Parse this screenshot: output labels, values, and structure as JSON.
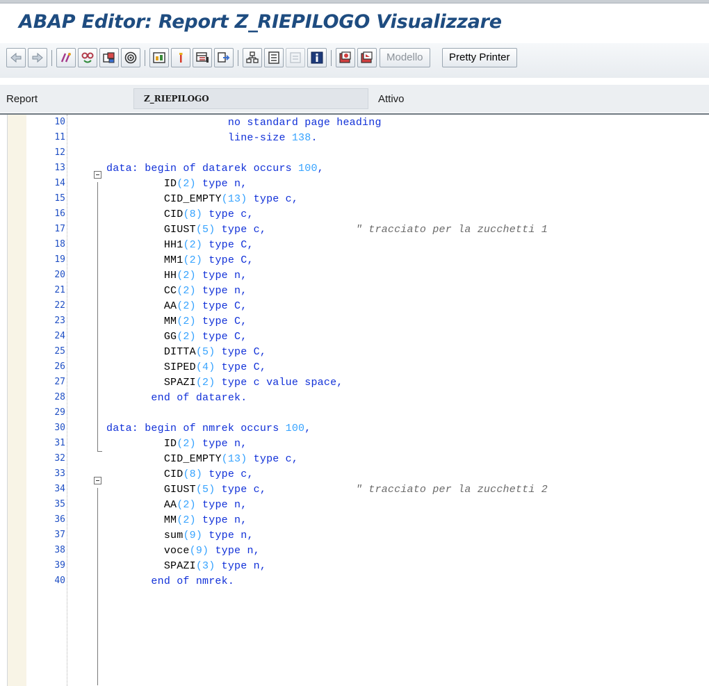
{
  "window": {
    "title": "ABAP Editor: Report Z_RIEPILOGO Visualizzare"
  },
  "toolbar": {
    "icons": [
      "back-arrow-icon",
      "forward-arrow-icon",
      "toggle-display-change-icon",
      "other-object-icon",
      "activate-icon",
      "where-used-icon",
      "navigate-icon",
      "object-list-icon",
      "display-object-icon",
      "insert-statement-icon",
      "breakpoint-icon",
      "bookmark-icon",
      "test-icon",
      "help-icon",
      "debug-icon",
      "session-debug-icon"
    ],
    "modello_label": "Modello",
    "pretty_printer_label": "Pretty Printer"
  },
  "report": {
    "label": "Report",
    "value": "Z_RIEPILOGO",
    "status": "Attivo"
  },
  "colors": {
    "keyword": "#1030d8",
    "number": "#36a3ff",
    "comment": "#6a6a6a",
    "linenum": "#1f4fc4",
    "title": "#1e4c80"
  },
  "code_lines": [
    {
      "n": "10",
      "parts": [
        {
          "t": "                   ",
          "k": "plain"
        },
        {
          "t": "no standard page heading",
          "k": "keyword"
        }
      ]
    },
    {
      "n": "11",
      "parts": [
        {
          "t": "                   ",
          "k": "plain"
        },
        {
          "t": "line-size ",
          "k": "keyword"
        },
        {
          "t": "138",
          "k": "number"
        },
        {
          "t": ".",
          "k": "keyword"
        }
      ]
    },
    {
      "n": "12",
      "parts": []
    },
    {
      "n": "13",
      "parts": [
        {
          "t": "data: begin of datarek occurs ",
          "k": "keyword"
        },
        {
          "t": "100",
          "k": "number"
        },
        {
          "t": ",",
          "k": "keyword"
        }
      ]
    },
    {
      "n": "14",
      "parts": [
        {
          "t": "         ",
          "k": "plain"
        },
        {
          "t": "ID",
          "k": "plain"
        },
        {
          "t": "(2)",
          "k": "number"
        },
        {
          "t": " type n,",
          "k": "keyword"
        }
      ]
    },
    {
      "n": "15",
      "parts": [
        {
          "t": "         ",
          "k": "plain"
        },
        {
          "t": "CID_EMPTY",
          "k": "plain"
        },
        {
          "t": "(13)",
          "k": "number"
        },
        {
          "t": " type c,",
          "k": "keyword"
        }
      ]
    },
    {
      "n": "16",
      "parts": [
        {
          "t": "         ",
          "k": "plain"
        },
        {
          "t": "CID",
          "k": "plain"
        },
        {
          "t": "(8)",
          "k": "number"
        },
        {
          "t": " type c,",
          "k": "keyword"
        }
      ]
    },
    {
      "n": "17",
      "parts": [
        {
          "t": "         ",
          "k": "plain"
        },
        {
          "t": "GIUST",
          "k": "plain"
        },
        {
          "t": "(5)",
          "k": "number"
        },
        {
          "t": " type c,",
          "k": "keyword"
        },
        {
          "t": "              \" tracciato per la zucchetti 1",
          "k": "comment"
        }
      ]
    },
    {
      "n": "18",
      "parts": [
        {
          "t": "         ",
          "k": "plain"
        },
        {
          "t": "HH1",
          "k": "plain"
        },
        {
          "t": "(2)",
          "k": "number"
        },
        {
          "t": " type C,",
          "k": "keyword"
        }
      ]
    },
    {
      "n": "19",
      "parts": [
        {
          "t": "         ",
          "k": "plain"
        },
        {
          "t": "MM1",
          "k": "plain"
        },
        {
          "t": "(2)",
          "k": "number"
        },
        {
          "t": " type C,",
          "k": "keyword"
        }
      ]
    },
    {
      "n": "20",
      "parts": [
        {
          "t": "         ",
          "k": "plain"
        },
        {
          "t": "HH",
          "k": "plain"
        },
        {
          "t": "(2)",
          "k": "number"
        },
        {
          "t": " type n,",
          "k": "keyword"
        }
      ]
    },
    {
      "n": "21",
      "parts": [
        {
          "t": "         ",
          "k": "plain"
        },
        {
          "t": "CC",
          "k": "plain"
        },
        {
          "t": "(2)",
          "k": "number"
        },
        {
          "t": " type n,",
          "k": "keyword"
        }
      ]
    },
    {
      "n": "22",
      "parts": [
        {
          "t": "         ",
          "k": "plain"
        },
        {
          "t": "AA",
          "k": "plain"
        },
        {
          "t": "(2)",
          "k": "number"
        },
        {
          "t": " type C,",
          "k": "keyword"
        }
      ]
    },
    {
      "n": "23",
      "parts": [
        {
          "t": "         ",
          "k": "plain"
        },
        {
          "t": "MM",
          "k": "plain"
        },
        {
          "t": "(2)",
          "k": "number"
        },
        {
          "t": " type C,",
          "k": "keyword"
        }
      ]
    },
    {
      "n": "24",
      "parts": [
        {
          "t": "         ",
          "k": "plain"
        },
        {
          "t": "GG",
          "k": "plain"
        },
        {
          "t": "(2)",
          "k": "number"
        },
        {
          "t": " type C,",
          "k": "keyword"
        }
      ]
    },
    {
      "n": "25",
      "parts": [
        {
          "t": "         ",
          "k": "plain"
        },
        {
          "t": "DITTA",
          "k": "plain"
        },
        {
          "t": "(5)",
          "k": "number"
        },
        {
          "t": " type C,",
          "k": "keyword"
        }
      ]
    },
    {
      "n": "26",
      "parts": [
        {
          "t": "         ",
          "k": "plain"
        },
        {
          "t": "SIPED",
          "k": "plain"
        },
        {
          "t": "(4)",
          "k": "number"
        },
        {
          "t": " type C,",
          "k": "keyword"
        }
      ]
    },
    {
      "n": "27",
      "parts": [
        {
          "t": "         ",
          "k": "plain"
        },
        {
          "t": "SPAZI",
          "k": "plain"
        },
        {
          "t": "(2)",
          "k": "number"
        },
        {
          "t": " type c value space,",
          "k": "keyword"
        }
      ]
    },
    {
      "n": "28",
      "parts": [
        {
          "t": "       ",
          "k": "plain"
        },
        {
          "t": "end of datarek.",
          "k": "keyword"
        }
      ]
    },
    {
      "n": "29",
      "parts": []
    },
    {
      "n": "30",
      "parts": [
        {
          "t": "data: begin of nmrek occurs ",
          "k": "keyword"
        },
        {
          "t": "100",
          "k": "number"
        },
        {
          "t": ",",
          "k": "keyword"
        }
      ]
    },
    {
      "n": "31",
      "parts": [
        {
          "t": "         ",
          "k": "plain"
        },
        {
          "t": "ID",
          "k": "plain"
        },
        {
          "t": "(2)",
          "k": "number"
        },
        {
          "t": " type n,",
          "k": "keyword"
        }
      ]
    },
    {
      "n": "32",
      "parts": [
        {
          "t": "         ",
          "k": "plain"
        },
        {
          "t": "CID_EMPTY",
          "k": "plain"
        },
        {
          "t": "(13)",
          "k": "number"
        },
        {
          "t": " type c,",
          "k": "keyword"
        }
      ]
    },
    {
      "n": "33",
      "parts": [
        {
          "t": "         ",
          "k": "plain"
        },
        {
          "t": "CID",
          "k": "plain"
        },
        {
          "t": "(8)",
          "k": "number"
        },
        {
          "t": " type c,",
          "k": "keyword"
        }
      ]
    },
    {
      "n": "34",
      "parts": [
        {
          "t": "         ",
          "k": "plain"
        },
        {
          "t": "GIUST",
          "k": "plain"
        },
        {
          "t": "(5)",
          "k": "number"
        },
        {
          "t": " type c,",
          "k": "keyword"
        },
        {
          "t": "              \" tracciato per la zucchetti 2",
          "k": "comment"
        }
      ]
    },
    {
      "n": "35",
      "parts": [
        {
          "t": "         ",
          "k": "plain"
        },
        {
          "t": "AA",
          "k": "plain"
        },
        {
          "t": "(2)",
          "k": "number"
        },
        {
          "t": " type n,",
          "k": "keyword"
        }
      ]
    },
    {
      "n": "36",
      "parts": [
        {
          "t": "         ",
          "k": "plain"
        },
        {
          "t": "MM",
          "k": "plain"
        },
        {
          "t": "(2)",
          "k": "number"
        },
        {
          "t": " type n,",
          "k": "keyword"
        }
      ]
    },
    {
      "n": "37",
      "parts": [
        {
          "t": "         ",
          "k": "plain"
        },
        {
          "t": "sum",
          "k": "plain"
        },
        {
          "t": "(9)",
          "k": "number"
        },
        {
          "t": " type n,",
          "k": "keyword"
        }
      ]
    },
    {
      "n": "38",
      "parts": [
        {
          "t": "         ",
          "k": "plain"
        },
        {
          "t": "voce",
          "k": "plain"
        },
        {
          "t": "(9)",
          "k": "number"
        },
        {
          "t": " type n,",
          "k": "keyword"
        }
      ]
    },
    {
      "n": "39",
      "parts": [
        {
          "t": "         ",
          "k": "plain"
        },
        {
          "t": "SPAZI",
          "k": "plain"
        },
        {
          "t": "(3)",
          "k": "number"
        },
        {
          "t": " type n,",
          "k": "keyword"
        }
      ]
    },
    {
      "n": "40",
      "parts": [
        {
          "t": "       ",
          "k": "plain"
        },
        {
          "t": "end of nmrek.",
          "k": "keyword"
        }
      ]
    }
  ]
}
